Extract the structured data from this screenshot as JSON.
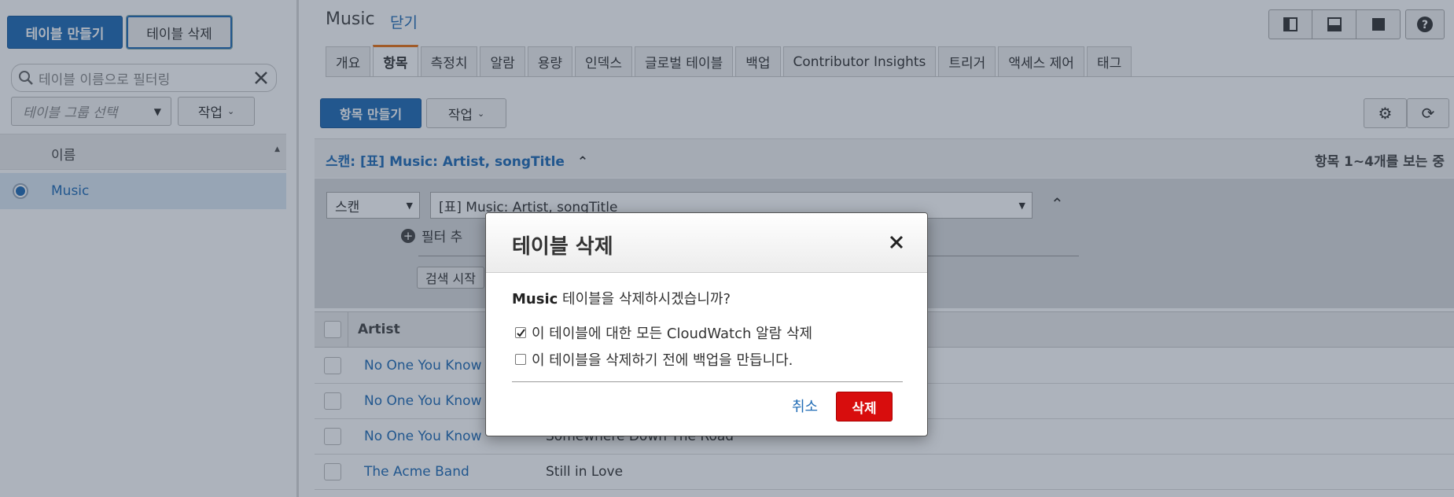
{
  "left": {
    "create_table": "테이블 만들기",
    "delete_table": "테이블 삭제",
    "filter_placeholder": "테이블 이름으로 필터링",
    "group_select": "테이블 그룹 선택",
    "actions": "작업",
    "col_name": "이름",
    "tables": [
      "Music"
    ]
  },
  "header": {
    "title": "Music",
    "close": "닫기"
  },
  "tabs": [
    "개요",
    "항목",
    "측정치",
    "알람",
    "용량",
    "인덱스",
    "글로벌 테이블",
    "백업",
    "Contributor Insights",
    "트리거",
    "액세스 제어",
    "태그"
  ],
  "active_tab": "항목",
  "toolbar": {
    "create_item": "항목 만들기",
    "actions": "작업"
  },
  "scan": {
    "title": "스캔: [표] Music: Artist, songTitle",
    "item_count": "항목 1~4개를 보는 중",
    "mode": "스캔",
    "target": "[표] Music: Artist, songTitle",
    "add_filter": "필터 추",
    "search_button": "검색 시작"
  },
  "table": {
    "col_artist": "Artist",
    "rows": [
      {
        "artist": "No One You Know",
        "song": ""
      },
      {
        "artist": "No One You Know",
        "song": ""
      },
      {
        "artist": "No One You Know",
        "song": "Somewhere Down The Road"
      },
      {
        "artist": "The Acme Band",
        "song": "Still in Love"
      }
    ]
  },
  "modal": {
    "title": "테이블 삭제",
    "table_name": "Music",
    "question_suffix": " 테이블을 삭제하시겠습니까?",
    "option_alarms": "이 테이블에 대한 모든 CloudWatch 알람 삭제",
    "option_alarms_checked": true,
    "option_backup": "이 테이블을 삭제하기 전에 백업을 만듭니다.",
    "option_backup_checked": false,
    "cancel": "취소",
    "delete": "삭제"
  },
  "colors": {
    "accent": "#1f6bb5",
    "danger": "#d80d0d",
    "tab_highlight": "#ec7211"
  }
}
